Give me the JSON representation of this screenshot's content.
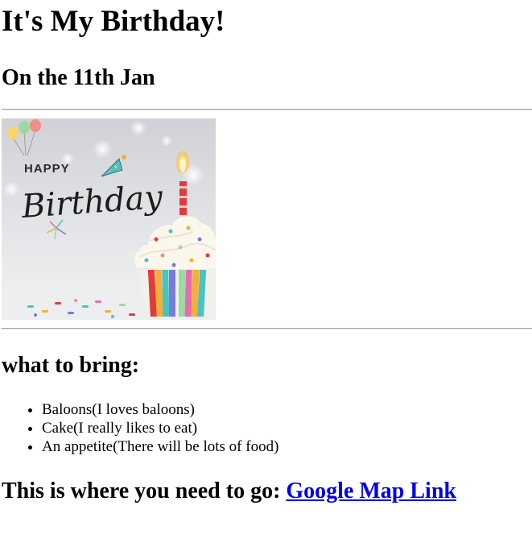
{
  "heading": {
    "title": "It's My Birthday!",
    "date": "On the 11th Jan"
  },
  "photo": {
    "alt_text": "Happy Birthday cupcake",
    "card_line1": "HAPPY",
    "card_line2": "Birthday"
  },
  "bring": {
    "title": "what to bring:",
    "items": [
      "Baloons(I loves baloons)",
      "Cake(I really likes to eat)",
      "An appetite(There will be lots of food)"
    ]
  },
  "directions": {
    "prefix": "This is where you need to go:",
    "link_label": "Google Map Link"
  },
  "colors": {
    "link": "#0000ee",
    "divider": "#a0a0a0"
  }
}
